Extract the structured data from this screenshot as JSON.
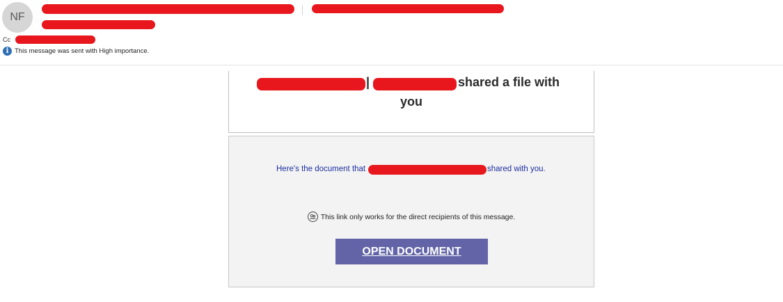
{
  "header": {
    "avatar_initials": "NF",
    "cc_label": "Cc",
    "importance_text": "This message was sent with High importance."
  },
  "message": {
    "heading_separator": "|",
    "heading_suffix": "shared a file with",
    "heading_line2": "you",
    "doc_prefix": "Here's the document that",
    "doc_suffix": "shared with you.",
    "link_notice": "This link only works for the direct recipients of this message.",
    "open_button": "OPEN DOCUMENT"
  },
  "icons": {
    "info": "info-icon",
    "people": "people-icon"
  },
  "colors": {
    "button_bg": "#6264a7",
    "redaction": "#e8171d",
    "link_text": "#1e2fa0",
    "info_icon": "#2f6fb5"
  }
}
